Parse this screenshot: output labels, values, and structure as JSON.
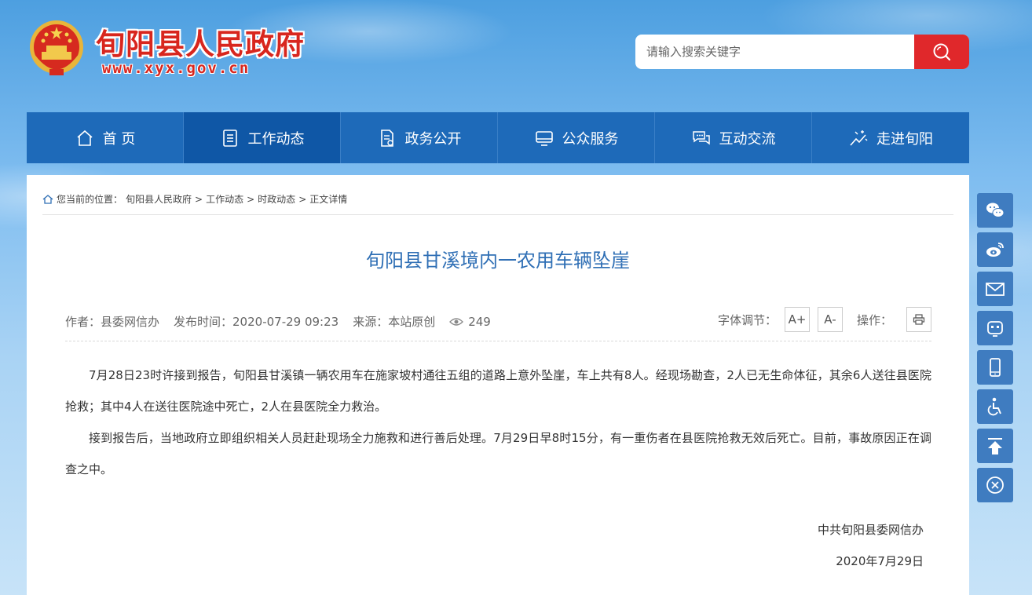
{
  "header": {
    "site_title": "旬阳县人民政府",
    "site_url": "www.xyx.gov.cn",
    "search_placeholder": "请输入搜索关键字"
  },
  "nav": {
    "items": [
      {
        "label": "首 页",
        "icon": "home-icon"
      },
      {
        "label": "工作动态",
        "icon": "document-list-icon"
      },
      {
        "label": "政务公开",
        "icon": "file-icon"
      },
      {
        "label": "公众服务",
        "icon": "monitor-icon"
      },
      {
        "label": "互动交流",
        "icon": "chat-icon"
      },
      {
        "label": "走进旬阳",
        "icon": "sparkle-icon"
      }
    ],
    "active_index": 1
  },
  "breadcrumb": {
    "prefix": "您当前的位置：",
    "items": [
      "旬阳县人民政府",
      "工作动态",
      "时政动态",
      "正文详情"
    ],
    "separator": ">"
  },
  "article": {
    "title": "旬阳县甘溪境内一农用车辆坠崖",
    "author": "作者：县委网信办",
    "publish_time": "发布时间：2020-07-29 09:23",
    "source": "来源：本站原创",
    "views": "249",
    "paragraphs": [
      "7月28日23时许接到报告，旬阳县甘溪镇一辆农用车在施家坡村通往五组的道路上意外坠崖，车上共有8人。经现场勘查，2人已无生命体征，其余6人送往县医院抢救；其中4人在送往医院途中死亡，2人在县医院全力救治。",
      "接到报告后，当地政府立即组织相关人员赶赴现场全力施救和进行善后处理。7月29日早8时15分，有一重伤者在县医院抢救无效后死亡。目前，事故原因正在调查之中。"
    ],
    "signature": "中共旬阳县委网信办",
    "date": "2020年7月29日"
  },
  "tools": {
    "font_label": "字体调节：",
    "font_increase": "A+",
    "font_decrease": "A-",
    "action_label": "操作："
  },
  "side_toolbar": [
    "wechat-icon",
    "weibo-icon",
    "mail-icon",
    "robot-icon",
    "mobile-icon",
    "accessibility-icon",
    "back-to-top-icon",
    "close-icon"
  ],
  "colors": {
    "brand_red": "#d8261e",
    "nav_blue": "#1e6ab9",
    "nav_active": "#0f57a6",
    "title_blue": "#2f6fb5",
    "search_red": "#e0282b",
    "side_blue": "#3f7cc0"
  }
}
